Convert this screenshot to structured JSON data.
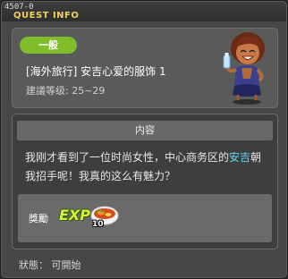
{
  "window": {
    "id": "4507-0",
    "title": "QUEST INFO"
  },
  "quest": {
    "category": "一般",
    "name": "[海外旅行] 安吉心爱的服饰 1",
    "level_requirement": "建議等级: 25~29",
    "npc_icon": "npc-character-icon"
  },
  "content": {
    "header": "内容",
    "description_before": "我刚才看到了一位时尚女性，中心商务区的",
    "highlight": "安吉",
    "description_after": "朝我招手呢！我真的这么有魅力？"
  },
  "rewards": {
    "label": "獎勵",
    "exp_label": "EXP",
    "item_icon": "food-bowl-icon",
    "item_count": "10"
  },
  "status": "狀態： 可開始",
  "colors": {
    "title": "#f0d25a",
    "category_badge": "#7fbd2a",
    "highlight": "#5fd8f0"
  }
}
